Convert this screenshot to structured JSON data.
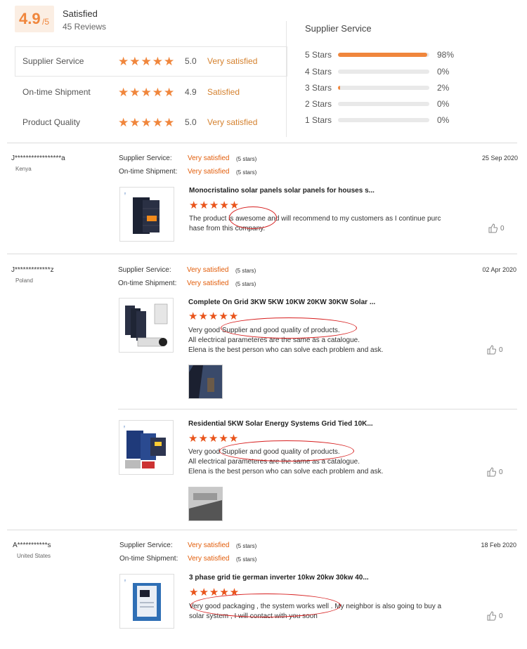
{
  "summary": {
    "score": "4.9",
    "score_suffix": "/5",
    "label": "Satisfied",
    "reviews": "45 Reviews"
  },
  "ratings": [
    {
      "label": "Supplier Service",
      "stars": "★★★★★",
      "value": "5.0",
      "text": "Very satisfied"
    },
    {
      "label": "On-time Shipment",
      "stars": "★★★★★",
      "value": "4.9",
      "text": "Satisfied"
    },
    {
      "label": "Product Quality",
      "stars": "★★★★★",
      "value": "5.0",
      "text": "Very satisfied"
    }
  ],
  "supplier_dist": {
    "title": "Supplier Service",
    "rows": [
      {
        "label": "5 Stars",
        "pct": "98%",
        "fill": 0.98
      },
      {
        "label": "4 Stars",
        "pct": "0%",
        "fill": 0
      },
      {
        "label": "3 Stars",
        "pct": "2%",
        "fill": 0.02
      },
      {
        "label": "2 Stars",
        "pct": "0%",
        "fill": 0
      },
      {
        "label": "1 Stars",
        "pct": "0%",
        "fill": 0
      }
    ]
  },
  "meta_labels": {
    "supplier": "Supplier Service:",
    "shipment": "On-time Shipment:",
    "stars_note": "(5 stars)"
  },
  "reviews": [
    {
      "user": "J*****************a",
      "country": "Kenya",
      "date": "25 Sep 2020",
      "supplier": "Very satisfied",
      "shipment": "Very satisfied",
      "items": [
        {
          "title": "Monocristalino solar panels solar panels for houses s...",
          "stars": "★★★★★",
          "lines": [
            "The product is awesome and will recommend to my customers as I continue purc",
            "hase from this company."
          ],
          "likes": "0"
        }
      ]
    },
    {
      "user": "J*************z",
      "country": "Poland",
      "date": "02 Apr 2020",
      "supplier": "Very satisfied",
      "shipment": "Very satisfied",
      "items": [
        {
          "title": "Complete On Grid 3KW 5KW 10KW 20KW 30KW Solar ...",
          "stars": "★★★★★",
          "lines": [
            "Very good Supplier and good quality of products.",
            "All electrical parameteres are the same as a catalogue.",
            "Elena is the best person who can solve each problem and ask."
          ],
          "likes": "0"
        },
        {
          "title": "Residential 5KW Solar Energy Systems Grid Tied 10K...",
          "stars": "★★★★★",
          "lines": [
            "Very good Supplier and good quality of products.",
            "All electrical parameteres are the same as a catalogue.",
            "Elena is the best person who can solve each problem and ask."
          ],
          "likes": "0"
        }
      ]
    },
    {
      "user": "A***********s",
      "country": "United States",
      "date": "18 Feb 2020",
      "supplier": "Very satisfied",
      "shipment": "Very satisfied",
      "items": [
        {
          "title": "3 phase grid tie german inverter 10kw 20kw 30kw 40...",
          "stars": "★★★★★",
          "lines": [
            "Very good packaging , the system works well . My neighbor is also going to buy a",
            "solar system , I will contact with you soon"
          ],
          "likes": "0"
        }
      ]
    }
  ],
  "colors": {
    "accent": "#f0863c",
    "review_star": "#e9541b",
    "highlight_oval": "#d71f1f",
    "value_text": "#e25d0a"
  },
  "icons": {
    "like": "thumbs-up-icon"
  }
}
